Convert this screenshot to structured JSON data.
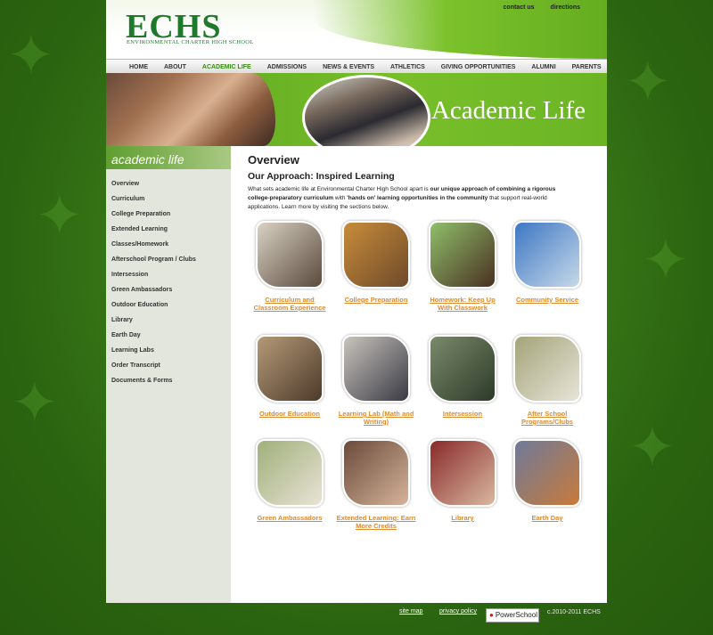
{
  "logo": {
    "text": "ECHS",
    "subtitle": "ENVIRONMENTAL CHARTER HIGH SCHOOL"
  },
  "top_links": [
    "contact us",
    "directions"
  ],
  "nav": [
    "HOME",
    "ABOUT",
    "ACADEMIC LIFE",
    "ADMISSIONS",
    "NEWS & EVENTS",
    "ATHLETICS",
    "GIVING OPPORTUNITIES",
    "ALUMNI",
    "PARENTS"
  ],
  "nav_active": "ACADEMIC LIFE",
  "banner": {
    "title": "Academic Life"
  },
  "sidebar": {
    "heading": "academic life",
    "items": [
      "Overview",
      "Curriculum",
      "College Preparation",
      "Extended Learning",
      "Classes/Homework",
      "Afterschool Program / Clubs",
      "Intersession",
      "Green Ambassadors",
      "Outdoor Education",
      "Library",
      "Earth Day",
      "Learning Labs",
      "Order Transcript",
      "Documents & Forms"
    ]
  },
  "main": {
    "title": "Overview",
    "subtitle": "Our Approach: Inspired Learning",
    "intro": {
      "p1": "What sets academic life at Environmental Charter High School apart is ",
      "b1": "our unique approach of combining a rigorous college-preparatory curriculum",
      "p2": " with ",
      "b2": "'hands on' learning opportunities in the community",
      "p3": " that support real-world applications.  Learn more by visiting the sections below."
    },
    "tiles": [
      {
        "label": "Curriculum and Classroom Experience",
        "colors": [
          "#d9d2c4",
          "#5a4a3c"
        ]
      },
      {
        "label": "College Preparation",
        "colors": [
          "#c88c3a",
          "#6e4a2a"
        ]
      },
      {
        "label": "Homework: Keep Up With Classwork",
        "colors": [
          "#8fbf6a",
          "#4a3022"
        ]
      },
      {
        "label": "Community Service",
        "colors": [
          "#3e77c4",
          "#c6d9e8"
        ]
      },
      {
        "label": "Outdoor Education",
        "colors": [
          "#b59a78",
          "#4c3a2a"
        ]
      },
      {
        "label": "Learning Lab (Math and Writing)",
        "colors": [
          "#c8c4bc",
          "#3a3a44"
        ]
      },
      {
        "label": "Intersession",
        "colors": [
          "#7a8a6a",
          "#2e3a2a"
        ]
      },
      {
        "label": "After School Programs/Clubs",
        "colors": [
          "#a4a47a",
          "#e8e4d8"
        ]
      },
      {
        "label": "Green Ambassadors",
        "colors": [
          "#9fb07a",
          "#e9e3d6"
        ]
      },
      {
        "label": "Extended Learning: Earn More Credits",
        "colors": [
          "#6a4a3a",
          "#d6b49a"
        ]
      },
      {
        "label": "Library",
        "colors": [
          "#8a2a2a",
          "#d8b8a0"
        ]
      },
      {
        "label": "Earth Day",
        "colors": [
          "#6f7a9a",
          "#c87a3a"
        ]
      }
    ]
  },
  "footer": {
    "site_map": "site map",
    "privacy": "privacy policy",
    "powerschool": "PowerSchool",
    "copyright": "c.2010-2011 ECHS"
  }
}
